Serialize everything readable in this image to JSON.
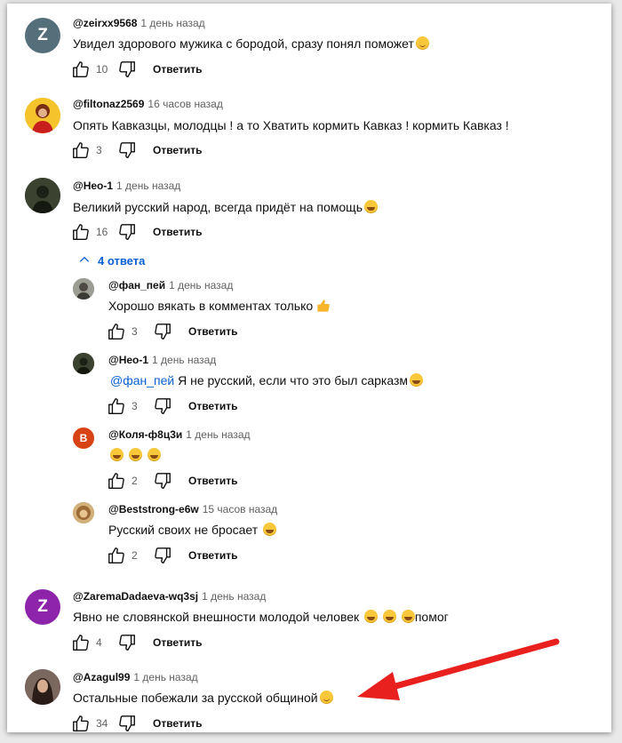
{
  "reply_label": "Ответить",
  "replies_toggle": "4 ответа",
  "comments": [
    {
      "author": "@zeirxx9568",
      "time": "1 день назад",
      "text": "Увидел здорового мужика с бородой, сразу понял поможет",
      "likes": "10",
      "avatar_letter": "Z",
      "avatar_color": "#546e7a"
    },
    {
      "author": "@filtonaz2569",
      "time": "16 часов назад",
      "text": "Опять  Кавказцы,  молодцы   !  а  то  Хватить  кормить  Кавказ ! кормить  Кавказ !",
      "likes": "3"
    },
    {
      "author": "@Нео-1",
      "time": "1 день назад",
      "text": "Великий русский народ, всегда придёт на помощь",
      "likes": "16"
    },
    {
      "author": "@ZaremaDadaeva-wq3sj",
      "time": "1 день назад",
      "text": "Явно не словянской внешности молодой человек",
      "text_after": "помог",
      "likes": "4",
      "avatar_letter": "Z",
      "avatar_color": "#8e24aa"
    },
    {
      "author": "@Azagul99",
      "time": "1 день назад",
      "text": "Остальные побежали за русской общиной",
      "likes": "34"
    }
  ],
  "replies": [
    {
      "author": "@фан_пей",
      "time": "1 день назад",
      "text": "Хорошо вякать в комментах только",
      "likes": "3"
    },
    {
      "author": "@Нео-1",
      "time": "1 день назад",
      "mention": "@фан_пей",
      "text": " Я не русский, если что это был сарказм",
      "likes": "3"
    },
    {
      "author": "@Коля-ф8ц3и",
      "time": "1 день назад",
      "text": "",
      "likes": "2",
      "avatar_letter": "В",
      "avatar_color": "#d84315"
    },
    {
      "author": "@Beststrong-e6w",
      "time": "15 часов назад",
      "text": "Русский своих не бросает",
      "likes": "2"
    }
  ],
  "colors": {
    "accent": "#065fd4",
    "annotation_arrow": "#e8201e"
  }
}
